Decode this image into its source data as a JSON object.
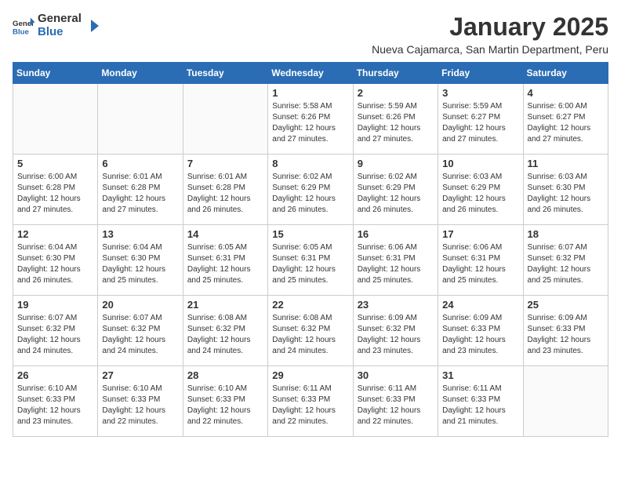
{
  "header": {
    "logo_general": "General",
    "logo_blue": "Blue",
    "title": "January 2025",
    "subtitle": "Nueva Cajamarca, San Martin Department, Peru"
  },
  "days_of_week": [
    "Sunday",
    "Monday",
    "Tuesday",
    "Wednesday",
    "Thursday",
    "Friday",
    "Saturday"
  ],
  "weeks": [
    [
      {
        "day": "",
        "info": ""
      },
      {
        "day": "",
        "info": ""
      },
      {
        "day": "",
        "info": ""
      },
      {
        "day": "1",
        "info": "Sunrise: 5:58 AM\nSunset: 6:26 PM\nDaylight: 12 hours\nand 27 minutes."
      },
      {
        "day": "2",
        "info": "Sunrise: 5:59 AM\nSunset: 6:26 PM\nDaylight: 12 hours\nand 27 minutes."
      },
      {
        "day": "3",
        "info": "Sunrise: 5:59 AM\nSunset: 6:27 PM\nDaylight: 12 hours\nand 27 minutes."
      },
      {
        "day": "4",
        "info": "Sunrise: 6:00 AM\nSunset: 6:27 PM\nDaylight: 12 hours\nand 27 minutes."
      }
    ],
    [
      {
        "day": "5",
        "info": "Sunrise: 6:00 AM\nSunset: 6:28 PM\nDaylight: 12 hours\nand 27 minutes."
      },
      {
        "day": "6",
        "info": "Sunrise: 6:01 AM\nSunset: 6:28 PM\nDaylight: 12 hours\nand 27 minutes."
      },
      {
        "day": "7",
        "info": "Sunrise: 6:01 AM\nSunset: 6:28 PM\nDaylight: 12 hours\nand 26 minutes."
      },
      {
        "day": "8",
        "info": "Sunrise: 6:02 AM\nSunset: 6:29 PM\nDaylight: 12 hours\nand 26 minutes."
      },
      {
        "day": "9",
        "info": "Sunrise: 6:02 AM\nSunset: 6:29 PM\nDaylight: 12 hours\nand 26 minutes."
      },
      {
        "day": "10",
        "info": "Sunrise: 6:03 AM\nSunset: 6:29 PM\nDaylight: 12 hours\nand 26 minutes."
      },
      {
        "day": "11",
        "info": "Sunrise: 6:03 AM\nSunset: 6:30 PM\nDaylight: 12 hours\nand 26 minutes."
      }
    ],
    [
      {
        "day": "12",
        "info": "Sunrise: 6:04 AM\nSunset: 6:30 PM\nDaylight: 12 hours\nand 26 minutes."
      },
      {
        "day": "13",
        "info": "Sunrise: 6:04 AM\nSunset: 6:30 PM\nDaylight: 12 hours\nand 25 minutes."
      },
      {
        "day": "14",
        "info": "Sunrise: 6:05 AM\nSunset: 6:31 PM\nDaylight: 12 hours\nand 25 minutes."
      },
      {
        "day": "15",
        "info": "Sunrise: 6:05 AM\nSunset: 6:31 PM\nDaylight: 12 hours\nand 25 minutes."
      },
      {
        "day": "16",
        "info": "Sunrise: 6:06 AM\nSunset: 6:31 PM\nDaylight: 12 hours\nand 25 minutes."
      },
      {
        "day": "17",
        "info": "Sunrise: 6:06 AM\nSunset: 6:31 PM\nDaylight: 12 hours\nand 25 minutes."
      },
      {
        "day": "18",
        "info": "Sunrise: 6:07 AM\nSunset: 6:32 PM\nDaylight: 12 hours\nand 25 minutes."
      }
    ],
    [
      {
        "day": "19",
        "info": "Sunrise: 6:07 AM\nSunset: 6:32 PM\nDaylight: 12 hours\nand 24 minutes."
      },
      {
        "day": "20",
        "info": "Sunrise: 6:07 AM\nSunset: 6:32 PM\nDaylight: 12 hours\nand 24 minutes."
      },
      {
        "day": "21",
        "info": "Sunrise: 6:08 AM\nSunset: 6:32 PM\nDaylight: 12 hours\nand 24 minutes."
      },
      {
        "day": "22",
        "info": "Sunrise: 6:08 AM\nSunset: 6:32 PM\nDaylight: 12 hours\nand 24 minutes."
      },
      {
        "day": "23",
        "info": "Sunrise: 6:09 AM\nSunset: 6:32 PM\nDaylight: 12 hours\nand 23 minutes."
      },
      {
        "day": "24",
        "info": "Sunrise: 6:09 AM\nSunset: 6:33 PM\nDaylight: 12 hours\nand 23 minutes."
      },
      {
        "day": "25",
        "info": "Sunrise: 6:09 AM\nSunset: 6:33 PM\nDaylight: 12 hours\nand 23 minutes."
      }
    ],
    [
      {
        "day": "26",
        "info": "Sunrise: 6:10 AM\nSunset: 6:33 PM\nDaylight: 12 hours\nand 23 minutes."
      },
      {
        "day": "27",
        "info": "Sunrise: 6:10 AM\nSunset: 6:33 PM\nDaylight: 12 hours\nand 22 minutes."
      },
      {
        "day": "28",
        "info": "Sunrise: 6:10 AM\nSunset: 6:33 PM\nDaylight: 12 hours\nand 22 minutes."
      },
      {
        "day": "29",
        "info": "Sunrise: 6:11 AM\nSunset: 6:33 PM\nDaylight: 12 hours\nand 22 minutes."
      },
      {
        "day": "30",
        "info": "Sunrise: 6:11 AM\nSunset: 6:33 PM\nDaylight: 12 hours\nand 22 minutes."
      },
      {
        "day": "31",
        "info": "Sunrise: 6:11 AM\nSunset: 6:33 PM\nDaylight: 12 hours\nand 21 minutes."
      },
      {
        "day": "",
        "info": ""
      }
    ]
  ]
}
